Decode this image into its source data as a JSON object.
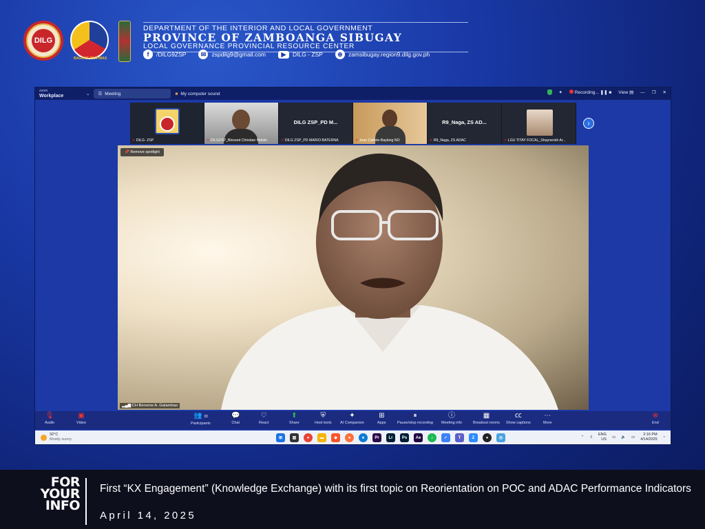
{
  "header": {
    "department": "DEPARTMENT OF THE INTERIOR AND LOCAL GOVERNMENT",
    "province": "PROVINCE OF ZAMBOANGA SIBUGAY",
    "center": "LOCAL GOVERNANCE PROVINCIAL RESOURCE CENTER",
    "dilg_logo_text": "DILG",
    "bp_caption": "BAGONG PILIPINAS",
    "contacts": {
      "facebook": "/DILG9ZSP",
      "email": "zspdilg9@gmail.com",
      "youtube": "DILG - ZSP",
      "website": "zamsibugay.region9.dilg.gov.ph"
    }
  },
  "zoom": {
    "brand_top": "zoom",
    "brand_bottom": "Workplace",
    "tab_meeting": "Meeting",
    "tab_sound": "My computer sound",
    "recording": "Recording...",
    "view": "View",
    "participants": [
      {
        "name": "DILG- ZSP"
      },
      {
        "name": "DILGZSP_Blessed Christian Mahilo"
      },
      {
        "name": "DILG ZSP_PD MARIO BATERNA",
        "center": "DILG ZSP_PD M..."
      },
      {
        "name": "Jean Cañete-Bayking NO"
      },
      {
        "name": "R9_Naga, ZS ADAC",
        "center": "R9_Naga, ZS AD..."
      },
      {
        "name": "LGU TITAY FOCAL_Shaynerish Ar..."
      }
    ],
    "spotlight_button": "Remove spotlight",
    "speaker": "CH Benonie A. Galambao",
    "toolbar": {
      "audio": "Audio",
      "video": "Video",
      "participants": "Participants",
      "participants_count": "33",
      "chat": "Chat",
      "react": "React",
      "share": "Share",
      "host_tools": "Host tools",
      "ai": "AI Companion",
      "apps": "Apps",
      "recording": "Pause/stop recording",
      "meeting_info": "Meeting info",
      "breakout": "Breakout rooms",
      "captions": "Show captions",
      "more": "More",
      "end": "End"
    },
    "taskbar": {
      "temp": "32°C",
      "weather": "Mostly sunny",
      "lang_top": "ENG",
      "lang_bottom": "US",
      "time": "2:16 PM",
      "date": "4/14/2025"
    }
  },
  "footer": {
    "fyi_1": "FOR",
    "fyi_2": "YOUR",
    "fyi_3": "INFO",
    "caption": "First “KX Engagement” (Knowledge Exchange) with its first topic on Reorientation on POC and ADAC Performance Indicators",
    "date": "April 14, 2025"
  }
}
